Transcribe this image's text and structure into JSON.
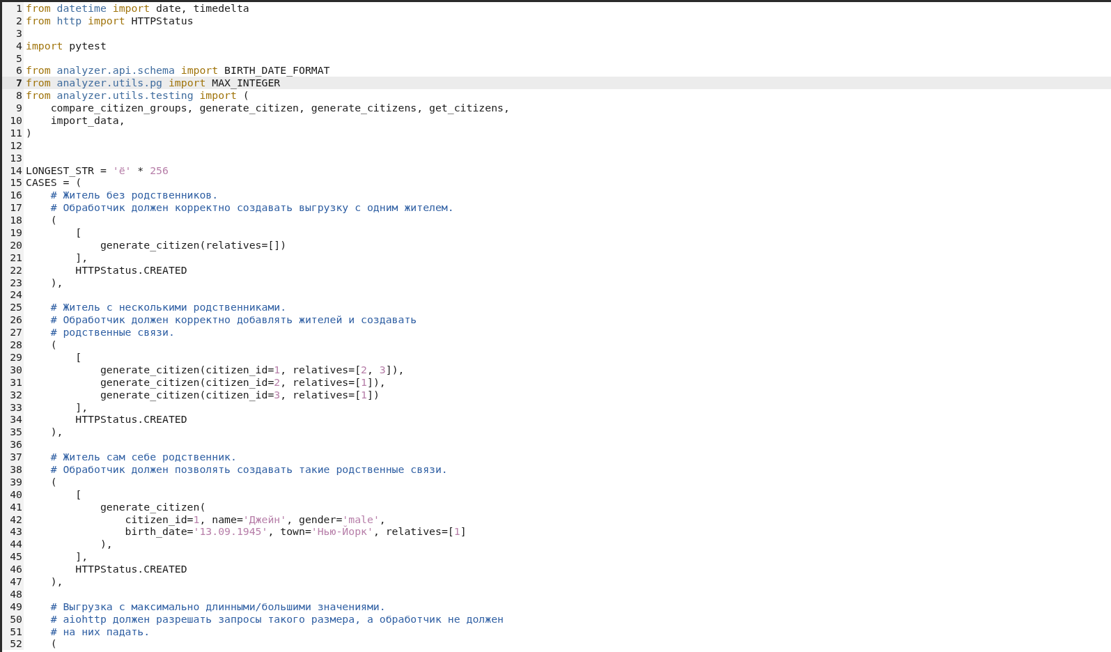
{
  "editor": {
    "lines": [
      {
        "number": "1",
        "current": false,
        "tokens": [
          {
            "kind": "keyword",
            "text": "from"
          },
          {
            "kind": "module",
            "text": " datetime"
          },
          {
            "kind": "keyword",
            "text": " import"
          },
          {
            "kind": "plain",
            "text": " date, timedelta"
          }
        ]
      },
      {
        "number": "2",
        "current": false,
        "tokens": [
          {
            "kind": "keyword",
            "text": "from"
          },
          {
            "kind": "module",
            "text": " http"
          },
          {
            "kind": "keyword",
            "text": " import"
          },
          {
            "kind": "plain",
            "text": " HTTPStatus"
          }
        ]
      },
      {
        "number": "3",
        "current": false
      },
      {
        "number": "4",
        "current": false,
        "tokens": [
          {
            "kind": "keyword",
            "text": "import"
          },
          {
            "kind": "plain",
            "text": " pytest"
          }
        ]
      },
      {
        "number": "5",
        "current": false
      },
      {
        "number": "6",
        "current": false,
        "tokens": [
          {
            "kind": "keyword",
            "text": "from"
          },
          {
            "kind": "module",
            "text": " analyzer.api.schema"
          },
          {
            "kind": "keyword",
            "text": " import"
          },
          {
            "kind": "plain",
            "text": " BIRTH_DATE_FORMAT"
          }
        ]
      },
      {
        "number": "7",
        "current": true,
        "tokens": [
          {
            "kind": "keyword",
            "text": "from"
          },
          {
            "kind": "module",
            "text": " analyzer.utils.pg"
          },
          {
            "kind": "keyword",
            "text": " import"
          },
          {
            "kind": "plain",
            "text": " MAX_INTEGER"
          }
        ]
      },
      {
        "number": "8",
        "current": false,
        "tokens": [
          {
            "kind": "keyword",
            "text": "from"
          },
          {
            "kind": "module",
            "text": " analyzer.utils.testing"
          },
          {
            "kind": "keyword",
            "text": " import"
          },
          {
            "kind": "plain",
            "text": " ("
          }
        ]
      },
      {
        "number": "9",
        "current": false,
        "tokens": [
          {
            "kind": "plain",
            "text": "    compare_citizen_groups, generate_citizen, generate_citizens, get_citizens,"
          }
        ]
      },
      {
        "number": "10",
        "current": false,
        "tokens": [
          {
            "kind": "plain",
            "text": "    import_data,"
          }
        ]
      },
      {
        "number": "11",
        "current": false,
        "tokens": [
          {
            "kind": "plain",
            "text": ")"
          }
        ]
      },
      {
        "number": "12",
        "current": false
      },
      {
        "number": "13",
        "current": false
      },
      {
        "number": "14",
        "current": false,
        "tokens": [
          {
            "kind": "plain",
            "text": "LONGEST_STR ="
          },
          {
            "kind": "string",
            "text": " 'ё'"
          },
          {
            "kind": "plain",
            "text": " *"
          },
          {
            "kind": "number",
            "text": " 256"
          }
        ]
      },
      {
        "number": "15",
        "current": false,
        "tokens": [
          {
            "kind": "plain",
            "text": "CASES = ("
          }
        ]
      },
      {
        "number": "16",
        "current": false,
        "tokens": [
          {
            "kind": "comment",
            "text": "    # Житель без родственников."
          }
        ]
      },
      {
        "number": "17",
        "current": false,
        "tokens": [
          {
            "kind": "comment",
            "text": "    # Обработчик должен корректно создавать выгрузку с одним жителем."
          }
        ]
      },
      {
        "number": "18",
        "current": false,
        "tokens": [
          {
            "kind": "plain",
            "text": "    ("
          }
        ]
      },
      {
        "number": "19",
        "current": false,
        "tokens": [
          {
            "kind": "plain",
            "text": "        ["
          }
        ]
      },
      {
        "number": "20",
        "current": false,
        "tokens": [
          {
            "kind": "plain",
            "text": "            generate_citizen(relatives=[])"
          }
        ]
      },
      {
        "number": "21",
        "current": false,
        "tokens": [
          {
            "kind": "plain",
            "text": "        ],"
          }
        ]
      },
      {
        "number": "22",
        "current": false,
        "tokens": [
          {
            "kind": "plain",
            "text": "        HTTPStatus.CREATED"
          }
        ]
      },
      {
        "number": "23",
        "current": false,
        "tokens": [
          {
            "kind": "plain",
            "text": "    ),"
          }
        ]
      },
      {
        "number": "24",
        "current": false
      },
      {
        "number": "25",
        "current": false,
        "tokens": [
          {
            "kind": "comment",
            "text": "    # Житель с несколькими родственниками."
          }
        ]
      },
      {
        "number": "26",
        "current": false,
        "tokens": [
          {
            "kind": "comment",
            "text": "    # Обработчик должен корректно добавлять жителей и создавать"
          }
        ]
      },
      {
        "number": "27",
        "current": false,
        "tokens": [
          {
            "kind": "comment",
            "text": "    # родственные связи."
          }
        ]
      },
      {
        "number": "28",
        "current": false,
        "tokens": [
          {
            "kind": "plain",
            "text": "    ("
          }
        ]
      },
      {
        "number": "29",
        "current": false,
        "tokens": [
          {
            "kind": "plain",
            "text": "        ["
          }
        ]
      },
      {
        "number": "30",
        "current": false,
        "tokens": [
          {
            "kind": "plain",
            "text": "            generate_citizen(citizen_id="
          },
          {
            "kind": "number",
            "text": "1"
          },
          {
            "kind": "plain",
            "text": ", relatives=["
          },
          {
            "kind": "number",
            "text": "2"
          },
          {
            "kind": "plain",
            "text": ", "
          },
          {
            "kind": "number",
            "text": "3"
          },
          {
            "kind": "plain",
            "text": "]),"
          }
        ]
      },
      {
        "number": "31",
        "current": false,
        "tokens": [
          {
            "kind": "plain",
            "text": "            generate_citizen(citizen_id="
          },
          {
            "kind": "number",
            "text": "2"
          },
          {
            "kind": "plain",
            "text": ", relatives=["
          },
          {
            "kind": "number",
            "text": "1"
          },
          {
            "kind": "plain",
            "text": "]),"
          }
        ]
      },
      {
        "number": "32",
        "current": false,
        "tokens": [
          {
            "kind": "plain",
            "text": "            generate_citizen(citizen_id="
          },
          {
            "kind": "number",
            "text": "3"
          },
          {
            "kind": "plain",
            "text": ", relatives=["
          },
          {
            "kind": "number",
            "text": "1"
          },
          {
            "kind": "plain",
            "text": "])"
          }
        ]
      },
      {
        "number": "33",
        "current": false,
        "tokens": [
          {
            "kind": "plain",
            "text": "        ],"
          }
        ]
      },
      {
        "number": "34",
        "current": false,
        "tokens": [
          {
            "kind": "plain",
            "text": "        HTTPStatus.CREATED"
          }
        ]
      },
      {
        "number": "35",
        "current": false,
        "tokens": [
          {
            "kind": "plain",
            "text": "    ),"
          }
        ]
      },
      {
        "number": "36",
        "current": false
      },
      {
        "number": "37",
        "current": false,
        "tokens": [
          {
            "kind": "comment",
            "text": "    # Житель сам себе родственник."
          }
        ]
      },
      {
        "number": "38",
        "current": false,
        "tokens": [
          {
            "kind": "comment",
            "text": "    # Обработчик должен позволять создавать такие родственные связи."
          }
        ]
      },
      {
        "number": "39",
        "current": false,
        "tokens": [
          {
            "kind": "plain",
            "text": "    ("
          }
        ]
      },
      {
        "number": "40",
        "current": false,
        "tokens": [
          {
            "kind": "plain",
            "text": "        ["
          }
        ]
      },
      {
        "number": "41",
        "current": false,
        "tokens": [
          {
            "kind": "plain",
            "text": "            generate_citizen("
          }
        ]
      },
      {
        "number": "42",
        "current": false,
        "tokens": [
          {
            "kind": "plain",
            "text": "                citizen_id="
          },
          {
            "kind": "number",
            "text": "1"
          },
          {
            "kind": "plain",
            "text": ", name="
          },
          {
            "kind": "string",
            "text": "'Джейн'"
          },
          {
            "kind": "plain",
            "text": ", gender="
          },
          {
            "kind": "string",
            "text": "'male'"
          },
          {
            "kind": "plain",
            "text": ","
          }
        ]
      },
      {
        "number": "43",
        "current": false,
        "tokens": [
          {
            "kind": "plain",
            "text": "                birth_date="
          },
          {
            "kind": "string",
            "text": "'13.09.1945'"
          },
          {
            "kind": "plain",
            "text": ", town="
          },
          {
            "kind": "string",
            "text": "'Нью-Йорк'"
          },
          {
            "kind": "plain",
            "text": ", relatives=["
          },
          {
            "kind": "number",
            "text": "1"
          },
          {
            "kind": "plain",
            "text": "]"
          }
        ]
      },
      {
        "number": "44",
        "current": false,
        "tokens": [
          {
            "kind": "plain",
            "text": "            ),"
          }
        ]
      },
      {
        "number": "45",
        "current": false,
        "tokens": [
          {
            "kind": "plain",
            "text": "        ],"
          }
        ]
      },
      {
        "number": "46",
        "current": false,
        "tokens": [
          {
            "kind": "plain",
            "text": "        HTTPStatus.CREATED"
          }
        ]
      },
      {
        "number": "47",
        "current": false,
        "tokens": [
          {
            "kind": "plain",
            "text": "    ),"
          }
        ]
      },
      {
        "number": "48",
        "current": false
      },
      {
        "number": "49",
        "current": false,
        "tokens": [
          {
            "kind": "comment",
            "text": "    # Выгрузка с максимально длинными/большими значениями."
          }
        ]
      },
      {
        "number": "50",
        "current": false,
        "tokens": [
          {
            "kind": "comment",
            "text": "    # aiohttp должен разрешать запросы такого размера, а обработчик не должен"
          }
        ]
      },
      {
        "number": "51",
        "current": false,
        "tokens": [
          {
            "kind": "comment",
            "text": "    # на них падать."
          }
        ]
      },
      {
        "number": "52",
        "current": false,
        "tokens": [
          {
            "kind": "plain",
            "text": "    ("
          }
        ]
      }
    ]
  }
}
